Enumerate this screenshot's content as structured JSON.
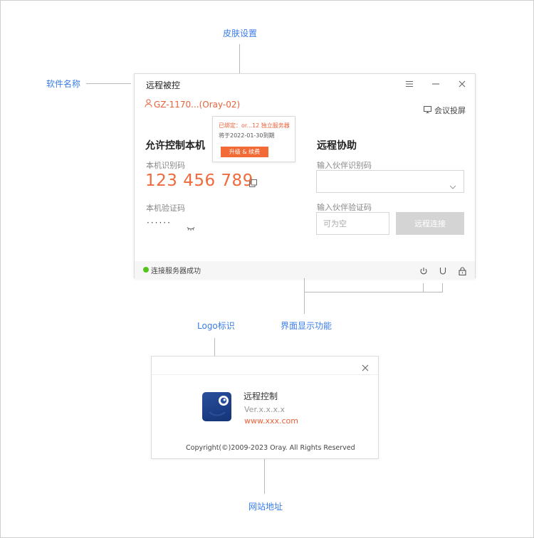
{
  "annotations": {
    "skin_settings": "皮肤设置",
    "software_name": "软件名称",
    "logo_mark": "Logo标识",
    "ui_features": "界面显示功能",
    "website": "网站地址"
  },
  "main_window": {
    "title": "远程被控",
    "device_id": "GZ-1170...(Oray-02)",
    "meeting_cast": "会议投屏",
    "allow_control": {
      "title": "允许控制本机",
      "id_label": "本机识别码",
      "id_value": "123 456 789",
      "verify_label": "本机验证码",
      "verify_masked": "······"
    },
    "remote_assist": {
      "title": "远程协助",
      "partner_id_label": "输入伙伴识别码",
      "partner_code_label": "输入伙伴验证码",
      "partner_code_placeholder": "可为空",
      "connect_label": "远程连接"
    },
    "status": {
      "text": "连接服务器成功",
      "color": "#52c41a"
    }
  },
  "skin_popup": {
    "line1": "已绑定：or...12 独立服务器",
    "line2": "将于2022-01-30到期",
    "button": "升级 & 续费"
  },
  "about_dialog": {
    "app_name": "远程控制",
    "version": "Ver.x.x.x.x",
    "url": "www.xxx.com",
    "copyright": "Copyright(©)2009-2023 Oray. All Rights Reserved"
  },
  "colors": {
    "accent": "#ef6a3c",
    "annotation": "#3b7de8",
    "logo_bg": "#1f4290"
  },
  "icons": [
    "menu-icon",
    "minimize-icon",
    "close-icon",
    "user-icon",
    "monitor-icon",
    "copy-icon",
    "eye-closed-icon",
    "chevron-down-icon",
    "power-icon",
    "magnet-icon",
    "lock-icon",
    "logo-icon"
  ]
}
